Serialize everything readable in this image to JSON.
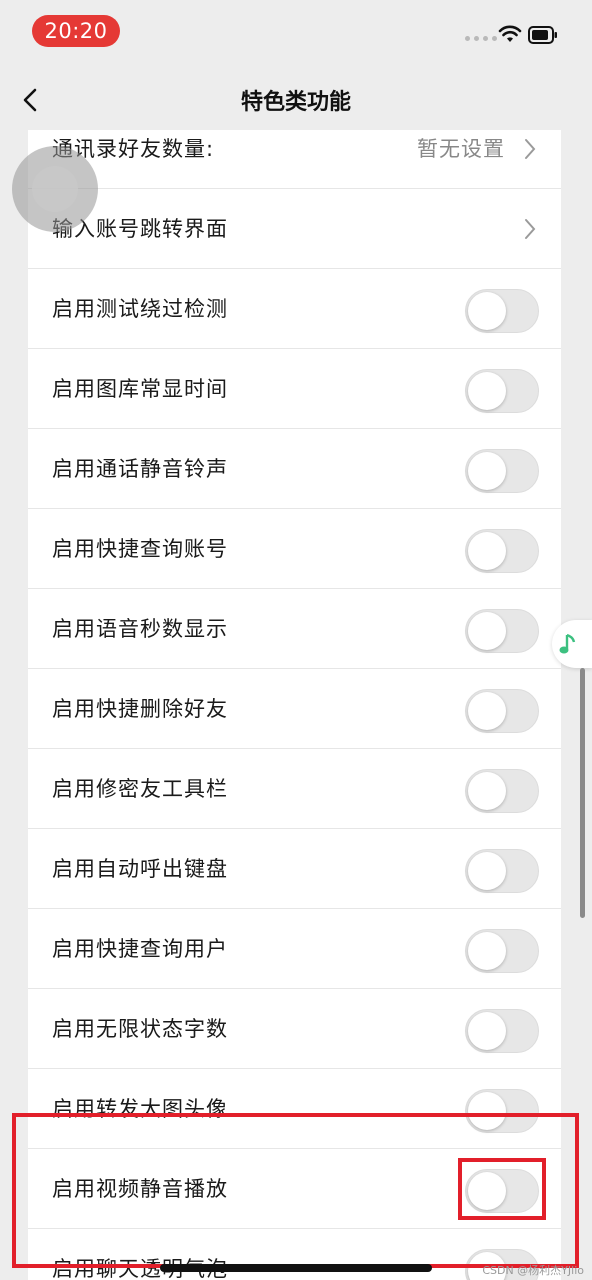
{
  "status_bar": {
    "time": "20:20"
  },
  "nav": {
    "title": "特色类功能",
    "back_icon": "chevron-left-icon"
  },
  "settings": [
    {
      "label": "通讯录好友数量:",
      "value": "暂无设置",
      "type": "link"
    },
    {
      "label": "输入账号跳转界面",
      "value": "",
      "type": "link"
    },
    {
      "label": "启用测试绕过检测",
      "type": "toggle",
      "on": false
    },
    {
      "label": "启用图库常显时间",
      "type": "toggle",
      "on": false
    },
    {
      "label": "启用通话静音铃声",
      "type": "toggle",
      "on": false
    },
    {
      "label": "启用快捷查询账号",
      "type": "toggle",
      "on": false
    },
    {
      "label": "启用语音秒数显示",
      "type": "toggle",
      "on": false
    },
    {
      "label": "启用快捷删除好友",
      "type": "toggle",
      "on": false
    },
    {
      "label": "启用修密友工具栏",
      "type": "toggle",
      "on": false
    },
    {
      "label": "启用自动呼出键盘",
      "type": "toggle",
      "on": false
    },
    {
      "label": "启用快捷查询用户",
      "type": "toggle",
      "on": false
    },
    {
      "label": "启用无限状态字数",
      "type": "toggle",
      "on": false
    },
    {
      "label": "启用转发大图头像",
      "type": "toggle",
      "on": false
    },
    {
      "label": "启用视频静音播放",
      "type": "toggle",
      "on": false
    },
    {
      "label": "启用聊天透明气泡",
      "type": "toggle",
      "on": false
    }
  ],
  "watermark": "CSDN @杨利杰YJlio",
  "colors": {
    "accent_red": "#e21f2a",
    "toggle_off": "#e7e7e7",
    "music_green": "#3cc080"
  }
}
